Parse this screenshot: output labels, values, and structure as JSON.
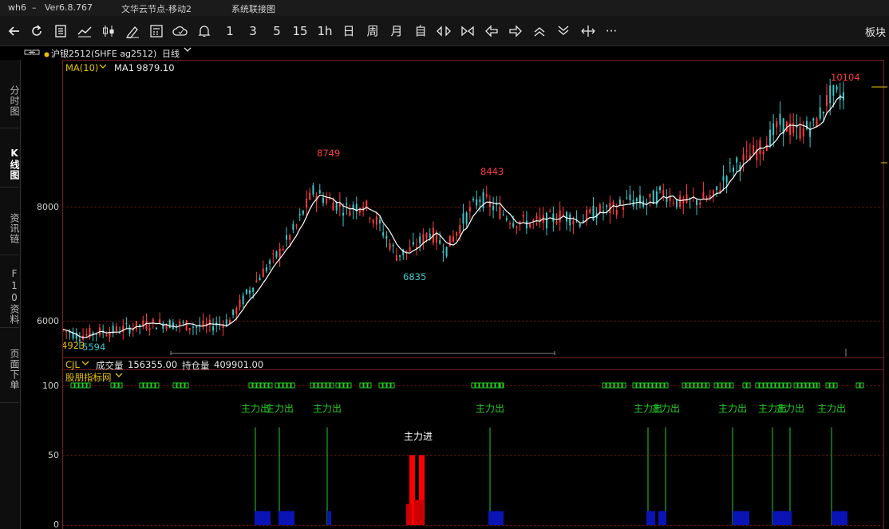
{
  "titlebar": {
    "app": "wh6",
    "sep": "–",
    "version": "Ver6.8.767",
    "server": "文华云节点-移动2",
    "menu_label": "系统联接图"
  },
  "toolbar": {
    "periods": [
      "1",
      "3",
      "5",
      "15",
      "1h",
      "日",
      "周",
      "月",
      "自"
    ],
    "more": "···",
    "sector_label": "板块"
  },
  "instrument": {
    "link_icon": "link-icon",
    "dot_color": "#e6c200",
    "name": "沪银2512(SHFE ag2512)",
    "period": "日线",
    "period_caret": "⌄"
  },
  "sidetabs": [
    {
      "label": "分时图",
      "active": false
    },
    {
      "label": "K线图",
      "active": true
    },
    {
      "label": "资讯链",
      "active": false
    },
    {
      "label": "F10资料",
      "active": false
    },
    {
      "label": "页面下单",
      "active": false
    }
  ],
  "main_legend": {
    "ma_label": "MA(10)",
    "ma1_label": "MA1",
    "ma1_value": "9879.10"
  },
  "volume_legend": {
    "indicator": "CJL",
    "volume_label": "成交量",
    "volume_value": "156355.00",
    "oi_label": "持仓量",
    "oi_value": "409901.00"
  },
  "indicator_legend": {
    "name": "股朋指标网"
  },
  "price_axis": {
    "labels": [
      "8000",
      "6000"
    ]
  },
  "indicator_axis": {
    "labels": [
      "100",
      "50",
      "0"
    ]
  },
  "colors": {
    "up": "#ff3c3c",
    "down": "#3cc8c8",
    "ma": "#ffffff",
    "signal_green": "#22cc22",
    "signal_blue": "#0a14b4",
    "signal_red": "#cc0000",
    "grid": "#7a1d1d"
  },
  "chart_data": [
    {
      "type": "line",
      "title": "沪银2512(SHFE ag2512) 日线",
      "series": [
        {
          "name": "MA1",
          "last_value": 9879.1
        }
      ],
      "ylabel": "",
      "yticks": [
        6000,
        8000
      ],
      "ylim": [
        5400,
        10600
      ],
      "annotations": [
        {
          "text": "8749",
          "kind": "high",
          "value": 8749
        },
        {
          "text": "6835",
          "kind": "low",
          "value": 6835
        },
        {
          "text": "8443",
          "kind": "high",
          "value": 8443
        },
        {
          "text": "10104",
          "kind": "high",
          "value": 10104
        },
        {
          "text": "5594",
          "kind": "low",
          "value": 5594
        },
        {
          "text": "4923",
          "kind": "label",
          "value": 4923
        }
      ],
      "trend_points": [
        [
          0,
          5880
        ],
        [
          10,
          5780
        ],
        [
          20,
          5840
        ],
        [
          30,
          5860
        ],
        [
          40,
          5920
        ],
        [
          50,
          5980
        ],
        [
          60,
          6000
        ],
        [
          70,
          5980
        ],
        [
          80,
          5940
        ],
        [
          90,
          5960
        ],
        [
          100,
          6050
        ],
        [
          110,
          6500
        ],
        [
          120,
          6900
        ],
        [
          130,
          7250
        ],
        [
          140,
          7700
        ],
        [
          150,
          8300
        ],
        [
          160,
          8150
        ],
        [
          170,
          8000
        ],
        [
          180,
          8100
        ],
        [
          190,
          7700
        ],
        [
          200,
          7200
        ],
        [
          210,
          7300
        ],
        [
          220,
          7600
        ],
        [
          230,
          7300
        ],
        [
          240,
          7800
        ],
        [
          250,
          8200
        ],
        [
          260,
          8000
        ],
        [
          270,
          7800
        ],
        [
          280,
          7750
        ],
        [
          290,
          7800
        ],
        [
          300,
          7900
        ],
        [
          310,
          7800
        ],
        [
          320,
          7950
        ],
        [
          330,
          8000
        ],
        [
          340,
          8150
        ],
        [
          350,
          8100
        ],
        [
          360,
          8300
        ],
        [
          370,
          8100
        ],
        [
          380,
          8150
        ],
        [
          390,
          8200
        ],
        [
          400,
          8700
        ],
        [
          410,
          8900
        ],
        [
          420,
          9100
        ],
        [
          430,
          9500
        ],
        [
          440,
          9350
        ],
        [
          450,
          9450
        ],
        [
          460,
          10000
        ]
      ]
    },
    {
      "type": "bar",
      "title": "股朋指标网",
      "ylim": [
        0,
        100
      ],
      "yticks": [
        0,
        50,
        100
      ],
      "signal_labels": [
        "主力出",
        "主力出",
        "主力出",
        "主力进",
        "主力出",
        "主力出",
        "主力出",
        "主力出",
        "主力出",
        "主力出",
        "主力出"
      ]
    }
  ]
}
